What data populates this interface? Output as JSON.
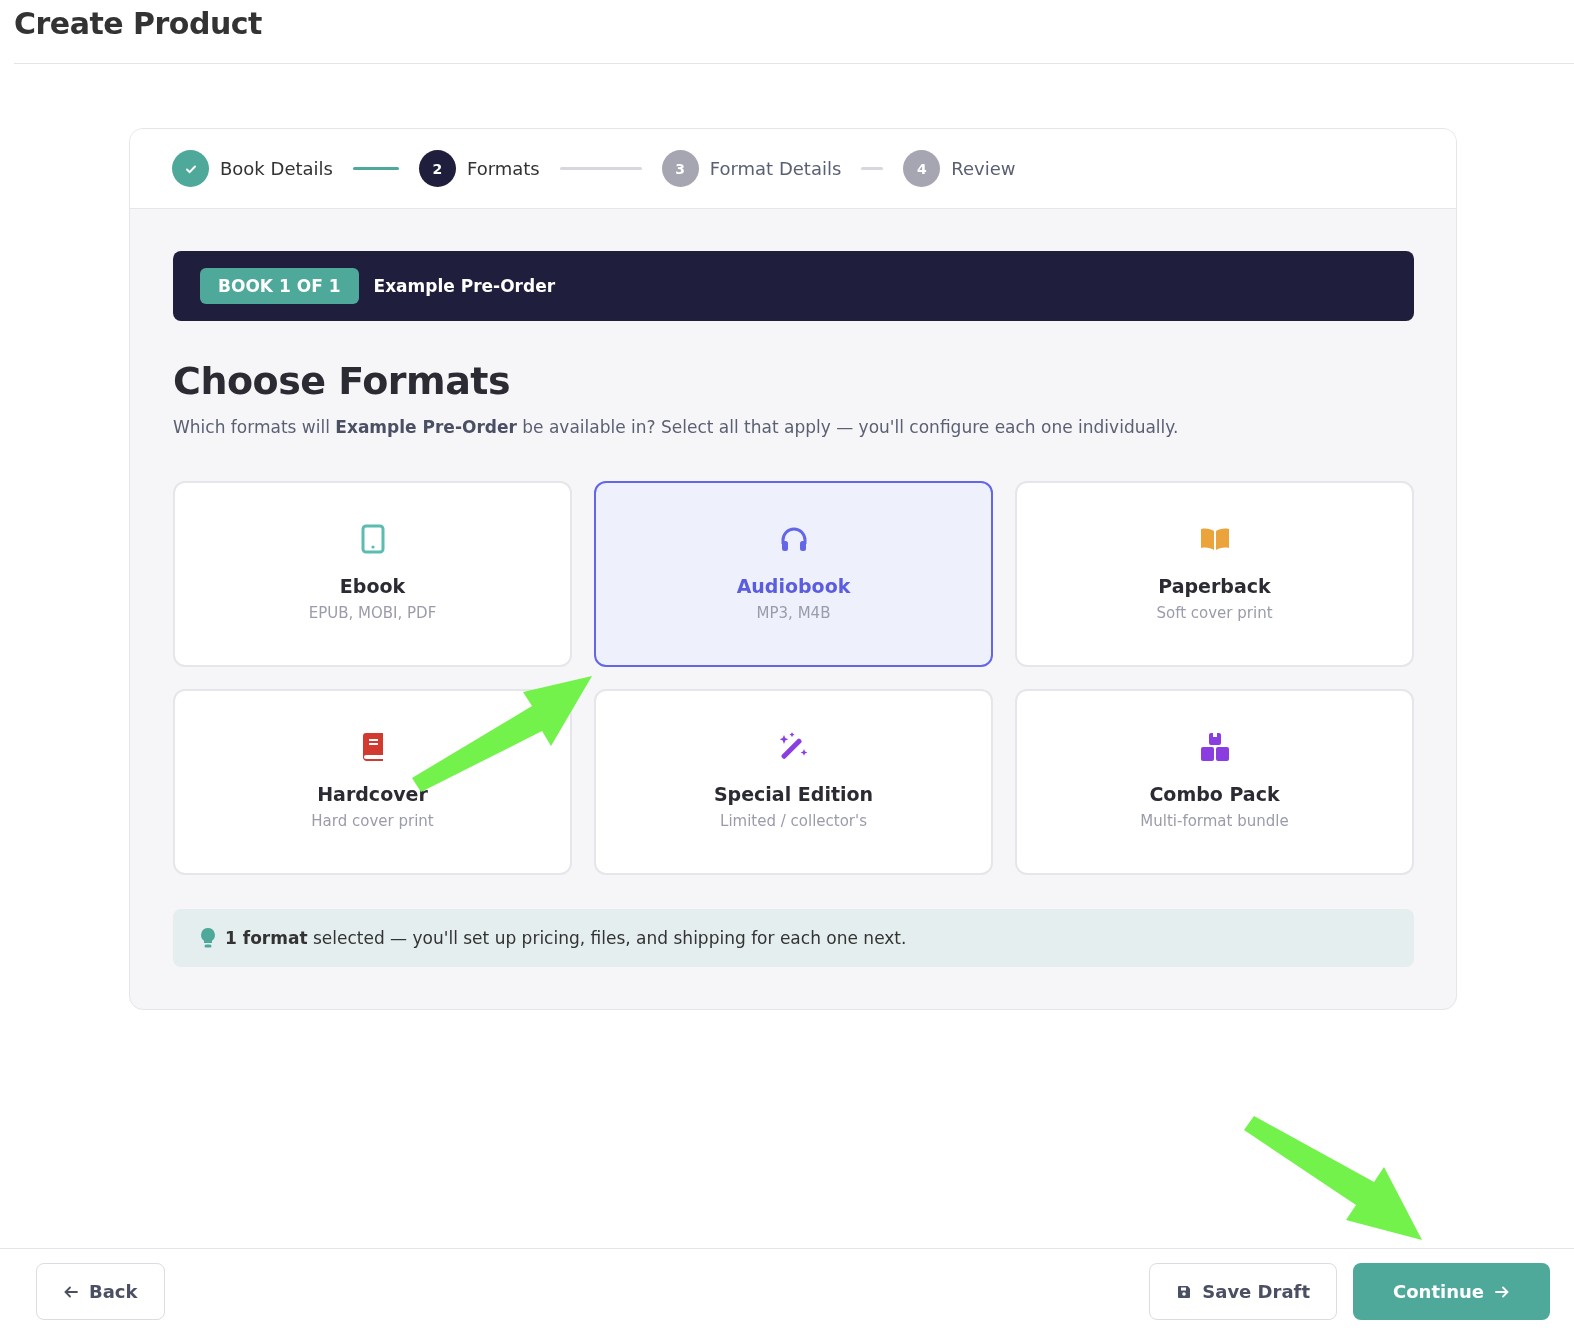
{
  "page": {
    "title": "Create Product"
  },
  "steps": [
    {
      "label": "Book Details",
      "completed": true,
      "selected": false
    },
    {
      "number": "2",
      "label": "Formats",
      "completed": false,
      "selected": true
    },
    {
      "number": "3",
      "label": "Format Details",
      "completed": false,
      "selected": false
    },
    {
      "number": "4",
      "label": "Review",
      "completed": false,
      "selected": false
    }
  ],
  "banner": {
    "badge": "BOOK 1 OF 1",
    "title": "Example Pre-Order"
  },
  "heading": "Choose Formats",
  "description": "Which formats will **Example Pre-Order** be available in? Select all that apply — you'll configure each one individually.",
  "formats": [
    {
      "title": "Ebook",
      "subtitle": "EPUB, MOBI, PDF",
      "selected": false
    },
    {
      "title": "Audiobook",
      "subtitle": "MP3, M4B",
      "selected": true
    },
    {
      "title": "Paperback",
      "subtitle": "Soft cover print",
      "selected": false
    },
    {
      "title": "Hardcover",
      "subtitle": "Hard cover print",
      "selected": false
    },
    {
      "title": "Special Edition",
      "subtitle": "Limited / collector's",
      "selected": false
    },
    {
      "title": "Combo Pack",
      "subtitle": "Multi-format bundle",
      "selected": false
    }
  ],
  "tip": "**1 format** selected — you'll set up pricing, files, and shipping for each one next.",
  "footer": {
    "back": "Back",
    "save": "Save Draft",
    "continue": "Continue"
  }
}
